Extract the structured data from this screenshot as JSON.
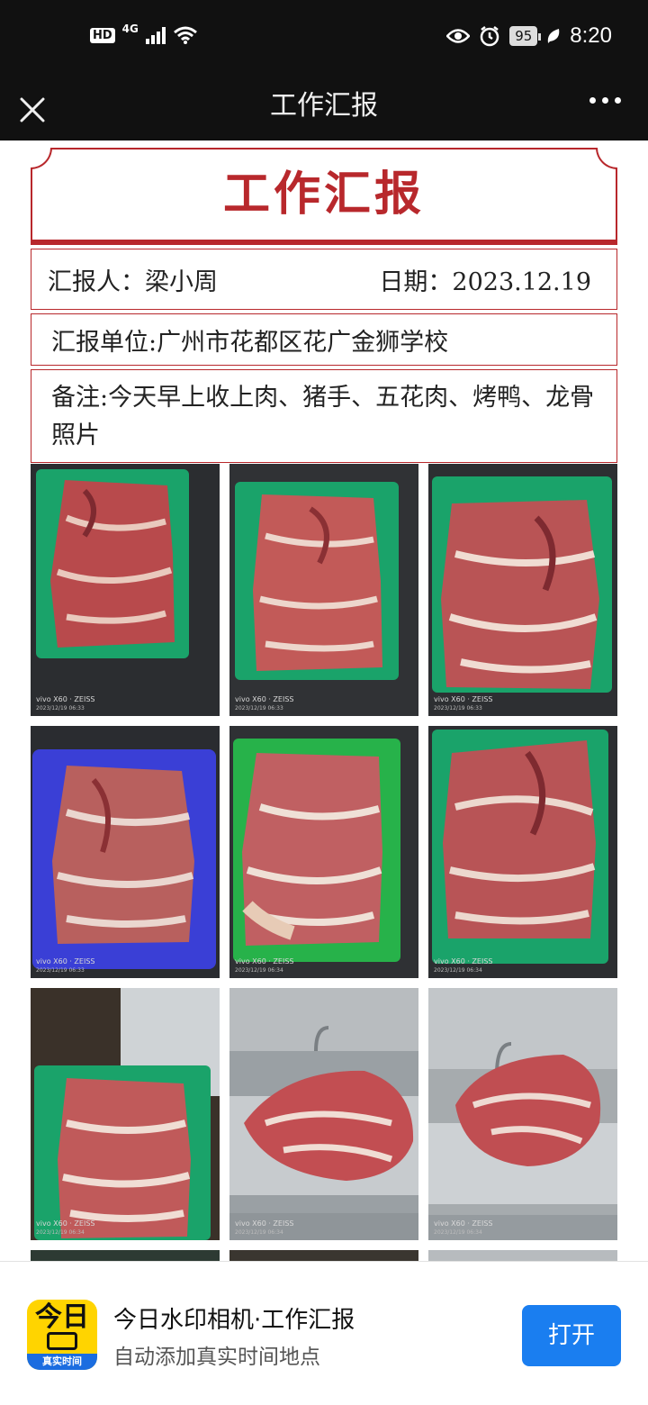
{
  "status_bar": {
    "hd": "HD",
    "network": "4G",
    "battery": "95",
    "time": "8:20",
    "icons": [
      "signal-icon",
      "wifi-icon",
      "eye-icon",
      "alarm-icon",
      "battery-icon",
      "leaf-icon"
    ]
  },
  "nav": {
    "title": "工作汇报",
    "close_icon": "close-icon",
    "more_icon": "more-icon"
  },
  "report": {
    "title": "工作汇报",
    "reporter": "汇报人：梁小周",
    "date": "日期：2023.12.19",
    "unit": "汇报单位:广州市花都区花广金狮学校",
    "note": "备注:今天早上收上肉、猪手、五花肉、烤鸭、龙骨照片",
    "accent_color": "#b8282c"
  },
  "photos": [
    {
      "name": "photo-pork-1",
      "basket": "#1aa36a",
      "wm": "vivo X60 · ZEISS",
      "ts": "2023/12/19 06:33"
    },
    {
      "name": "photo-pork-2",
      "basket": "#1aa36a",
      "wm": "vivo X60 · ZEISS",
      "ts": "2023/12/19 06:33"
    },
    {
      "name": "photo-pork-3",
      "basket": "#1aa36a",
      "wm": "vivo X60 · ZEISS",
      "ts": "2023/12/19 06:33"
    },
    {
      "name": "photo-pork-4",
      "basket": "#3a3fd6",
      "wm": "vivo X60 · ZEISS",
      "ts": "2023/12/19 06:33"
    },
    {
      "name": "photo-pork-5",
      "basket": "#27b24a",
      "wm": "vivo X60 · ZEISS",
      "ts": "2023/12/19 06:34"
    },
    {
      "name": "photo-pork-6",
      "basket": "#1aa36a",
      "wm": "vivo X60 · ZEISS",
      "ts": "2023/12/19 06:34"
    },
    {
      "name": "photo-pork-7",
      "basket": "#1aa36a",
      "wm": "vivo X60 · ZEISS",
      "ts": "2023/12/19 06:34"
    },
    {
      "name": "photo-pork-sink-1",
      "basket": "",
      "wm": "vivo X60 · ZEISS",
      "ts": "2023/12/19 06:34"
    },
    {
      "name": "photo-pork-sink-2",
      "basket": "",
      "wm": "vivo X60 · ZEISS",
      "ts": "2023/12/19 06:34"
    }
  ],
  "banner": {
    "icon_big": "今日",
    "icon_strip": "真实时间",
    "title": "今日水印相机·工作汇报",
    "subtitle": "自动添加真实时间地点",
    "button": "打开",
    "button_color": "#1a7ef0"
  }
}
